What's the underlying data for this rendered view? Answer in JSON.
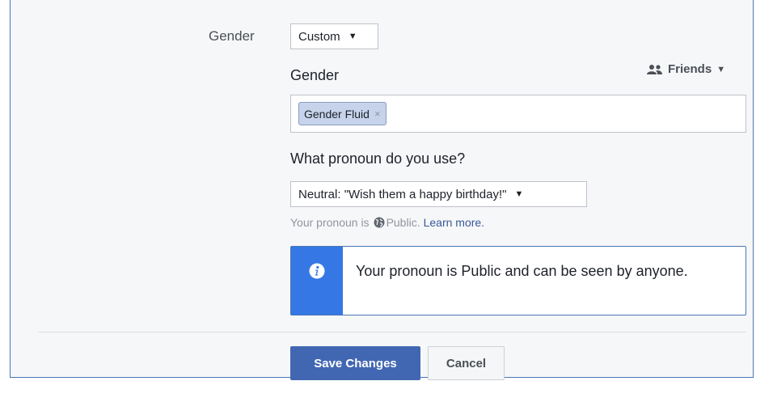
{
  "form": {
    "gender_row_label": "Gender",
    "gender_select_value": "Custom",
    "gender_field_label": "Gender",
    "audience": {
      "label": "Friends",
      "icon": "friends-icon"
    },
    "gender_tokens": [
      {
        "label": "Gender Fluid",
        "remove_symbol": "×"
      }
    ],
    "pronoun_question": "What pronoun do you use?",
    "pronoun_select_value": "Neutral: \"Wish them a happy birthday!\"",
    "hint": {
      "prefix": "Your pronoun is",
      "audience": "Public.",
      "link": "Learn more."
    },
    "info_message": "Your pronoun is Public and can be seen by anyone."
  },
  "buttons": {
    "save": "Save Changes",
    "cancel": "Cancel"
  },
  "colors": {
    "primary": "#4267b2",
    "info_bar": "#3578e5",
    "panel_bg": "#f6f7f9",
    "link": "#385898"
  }
}
